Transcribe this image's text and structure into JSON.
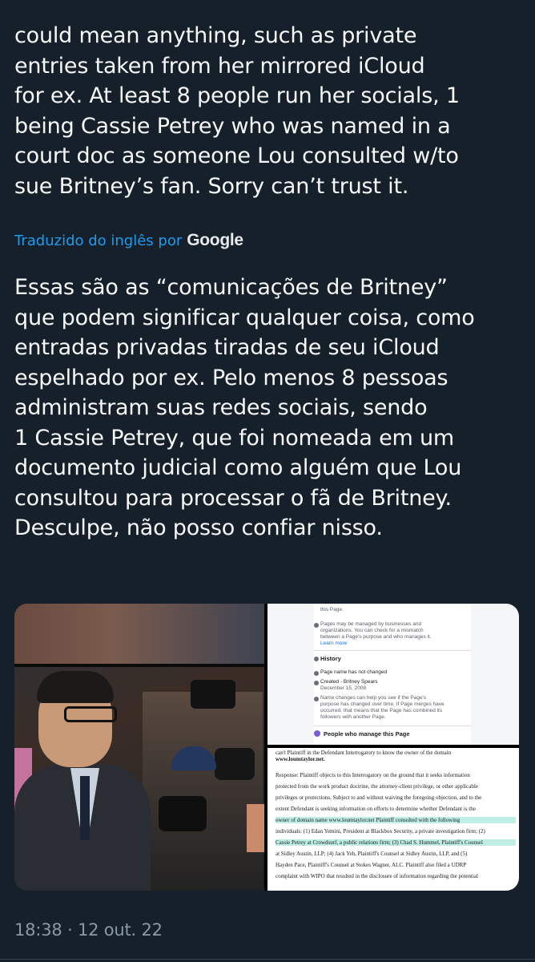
{
  "tweet": {
    "text_lines": [
      "could mean anything, such as private",
      "entries taken from her mirrored iCloud",
      "for ex. At least 8 people run her socials, 1",
      "being Cassie Petrey who was named in a",
      "court doc as someone Lou consulted w/to",
      "sue Britney’s fan. Sorry can’t trust it."
    ],
    "translation_label": "Traduzido do inglês por",
    "translation_provider": "Google",
    "translated_lines": [
      "Essas são as “comunicações de Britney”",
      "que podem significar qualquer coisa, como",
      "entradas privadas tiradas de seu iCloud",
      "espelhado por ex. Pelo menos 8 pessoas",
      "administram suas redes sociais, sendo",
      "1 Cassie Petrey, que foi nomeada em um",
      "documento judicial como alguém que Lou",
      "consultou para processar o fã de Britney.",
      "Desculpe, não posso confiar nisso."
    ],
    "timestamp": "18:38 · 12 out. 22"
  },
  "media": {
    "doc_top": {
      "intro": "this Page.",
      "info_lines": [
        "Pages may be managed by businesses and",
        "organizations. You can check for a mismatch",
        "between a Page's purpose and who manages it."
      ],
      "learn_more": "Learn more",
      "history_heading": "History",
      "name_unchanged": "Page name has not changed",
      "created": "Created - Britney Spears",
      "created_date": "December 15, 2008",
      "name_changes": [
        "Name changes can help you see if the Page's",
        "purpose has changed over time. If Page merges have",
        "occurred, that means that the Page has combined its",
        "followers with another Page."
      ],
      "people_heading": "People who manage this Page"
    },
    "doc_bottom": {
      "lines": [
        "can't Plaintiff in the Defendant Interrogatory to know the owner of the domain",
        "www.loumtaylor.net.",
        "",
        "Response: Plaintiff objects to this Interrogatory on the ground that it seeks information",
        "protected from the work product doctrine, the attorney-client privilege, or other applicable",
        "privileges or protections. Subject to and without waiving the foregoing objection, and to the",
        "extent Defendant is seeking information on efforts to determine whether Defendant is the",
        "owner of domain name www.loumtaylor.net Plaintiff consulted with the following",
        "individuals: (1) Edan Yemini, President at Blackbox Security, a private investigation firm; (2)",
        "Cassie Petrey at Crowdsurf, a public relations firm; (3) Chad S. Hummel, Plaintiff's Counsel",
        "at Sidley Austin, LLP; (4) Jack Yeh, Plaintiff's Counsel at Sidley Austin, LLP, and (5)",
        "Hayden Pace, Plaintiff's Counsel at Stokes Wagner, ALC. Plaintiff also filed a UDRP",
        "complaint with WIPO that resulted in the disclosure of information regarding the potential"
      ]
    }
  }
}
